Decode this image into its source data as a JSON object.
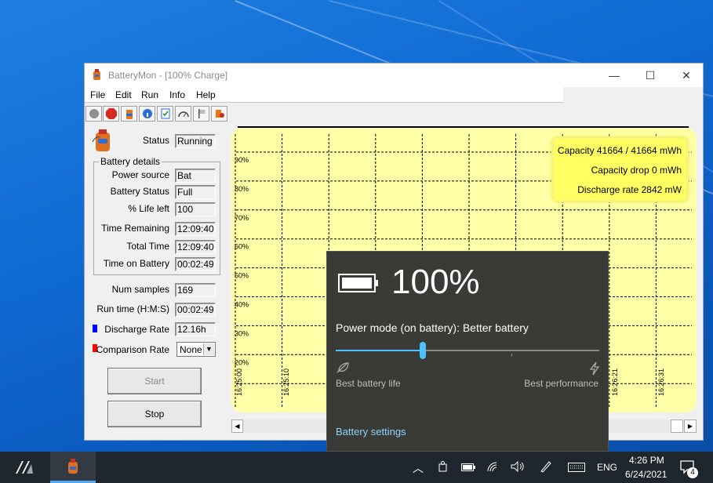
{
  "window": {
    "title": "BatteryMon - [100% Charge]",
    "controls": {
      "minimize": "—",
      "maximize": "☐",
      "close": "✕"
    }
  },
  "menu": [
    "File",
    "Edit",
    "Run",
    "Info",
    "Help"
  ],
  "toolbar_icons": [
    "stop-circle-icon",
    "stop-sign-icon",
    "battery-icon",
    "info-icon",
    "checklist-icon",
    "gauge-icon",
    "flag-icon",
    "settings-icon"
  ],
  "panel": {
    "status_label": "Status",
    "status_value": "Running",
    "group_label": "Battery details",
    "details": [
      {
        "label": "Power source",
        "value": "Bat"
      },
      {
        "label": "Battery Status",
        "value": "Full"
      },
      {
        "label": "% Life left",
        "value": "100"
      },
      {
        "label": "Time Remaining",
        "value": "12:09:40"
      },
      {
        "label": "Total Time",
        "value": "12:09:40"
      },
      {
        "label": "Time on Battery",
        "value": "00:02:49"
      }
    ],
    "num_samples_label": "Num samples",
    "num_samples_value": "169",
    "run_time_label": "Run time (H:M:S)",
    "run_time_value": "00:02:49",
    "discharge_label": "Discharge Rate",
    "discharge_value": "12.16h",
    "comparison_label": "Comparison Rate",
    "comparison_value": "None",
    "discharge_color": "#0000ff",
    "comparison_color": "#ff0000",
    "start_label": "Start",
    "stop_label": "Stop"
  },
  "chart_data": {
    "type": "line",
    "y_ticks": [
      "90%",
      "80%",
      "70%",
      "60%",
      "50%",
      "40%",
      "30%",
      "20%"
    ],
    "x_ticks_left": [
      "16:25:00",
      "16:25:10"
    ],
    "x_ticks_right": [
      "16:26:21",
      "16:26:31"
    ],
    "background": "#ffffa8",
    "grid": true,
    "info_lines": [
      "Capacity 41664 / 41664 mWh",
      "Capacity drop 0 mWh",
      "Discharge rate 2842 mW"
    ]
  },
  "flyout": {
    "percent": "100%",
    "power_mode": "Power mode (on battery): Better battery",
    "slider_value": 0.33,
    "left_label": "Best battery life",
    "right_label": "Best performance",
    "settings_link": "Battery settings",
    "accent": "#4cc2ff"
  },
  "taskbar": {
    "language": "ENG",
    "time": "4:26 PM",
    "date": "6/24/2021",
    "notification_count": "4"
  }
}
